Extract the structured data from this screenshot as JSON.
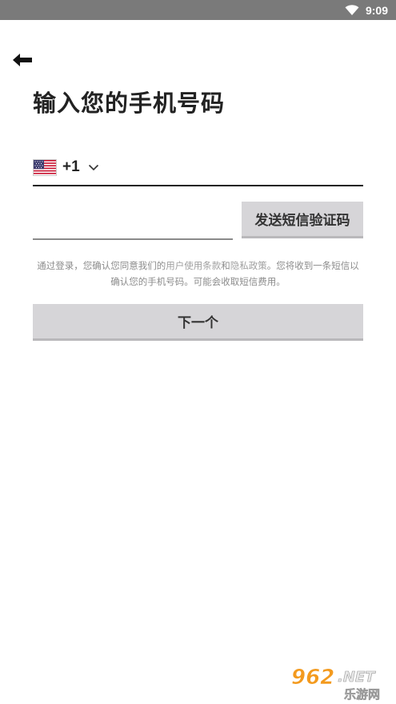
{
  "status_bar": {
    "time": "9:09"
  },
  "page": {
    "title": "输入您的手机号码"
  },
  "phone": {
    "country_code": "+1",
    "number": "",
    "placeholder": ""
  },
  "verification": {
    "code": "",
    "placeholder": "",
    "send_button_label": "发送短信验证码"
  },
  "terms": {
    "prefix": "通过登录，您确认您同意我们的",
    "terms_link": "用户使用条款",
    "conjunction": "和",
    "privacy_link": "隐私政策",
    "suffix": "。您将收到一条短信以确认您的手机号码。可能会收取短信费用。"
  },
  "next_button_label": "下一个",
  "watermark": {
    "logo_text": "962.NET",
    "logo_subtext": "乐游网"
  },
  "colors": {
    "status_bar": "#7a7a7a",
    "button_bg": "#d6d5d8",
    "underline": "#1d1d1d",
    "terms_text": "#8c8c8c",
    "watermark_orange": "#f39a1e"
  }
}
